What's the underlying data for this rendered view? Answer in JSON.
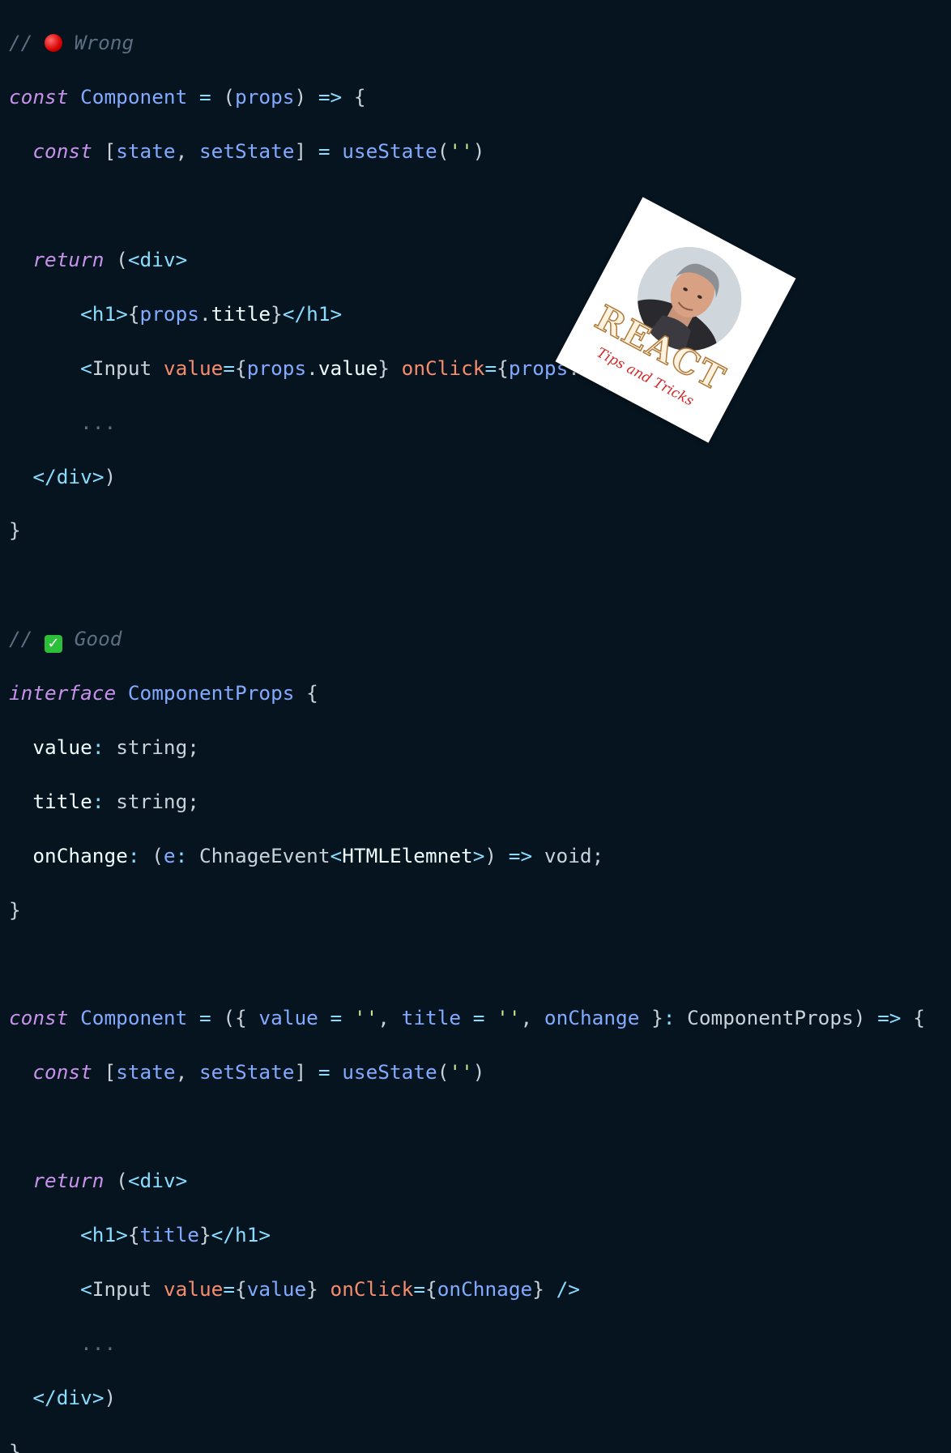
{
  "code": {
    "wrong_comment": "// ",
    "wrong_label": "Wrong",
    "good_comment": "// ",
    "good_label": "Good",
    "kw_const": "const",
    "kw_return": "return",
    "kw_interface": "interface",
    "component": "Component",
    "props": "props",
    "state": "state",
    "setState": "setState",
    "useState": "useState",
    "empty_string": "''",
    "div": "div",
    "h1": "h1",
    "Input": "Input",
    "value": "value",
    "onClick": "onClick",
    "title": "title",
    "onChnage": "onChnage",
    "ellipsis": "...",
    "ComponentProps": "ComponentProps",
    "string_type": "string",
    "onChange": "onChange",
    "e": "e",
    "ChnageEvent": "ChnageEvent",
    "HTMLElemnet": "HTMLElemnet",
    "void": "void"
  },
  "badge": {
    "title": "REACT",
    "subtitle": "Tips and Tricks"
  }
}
